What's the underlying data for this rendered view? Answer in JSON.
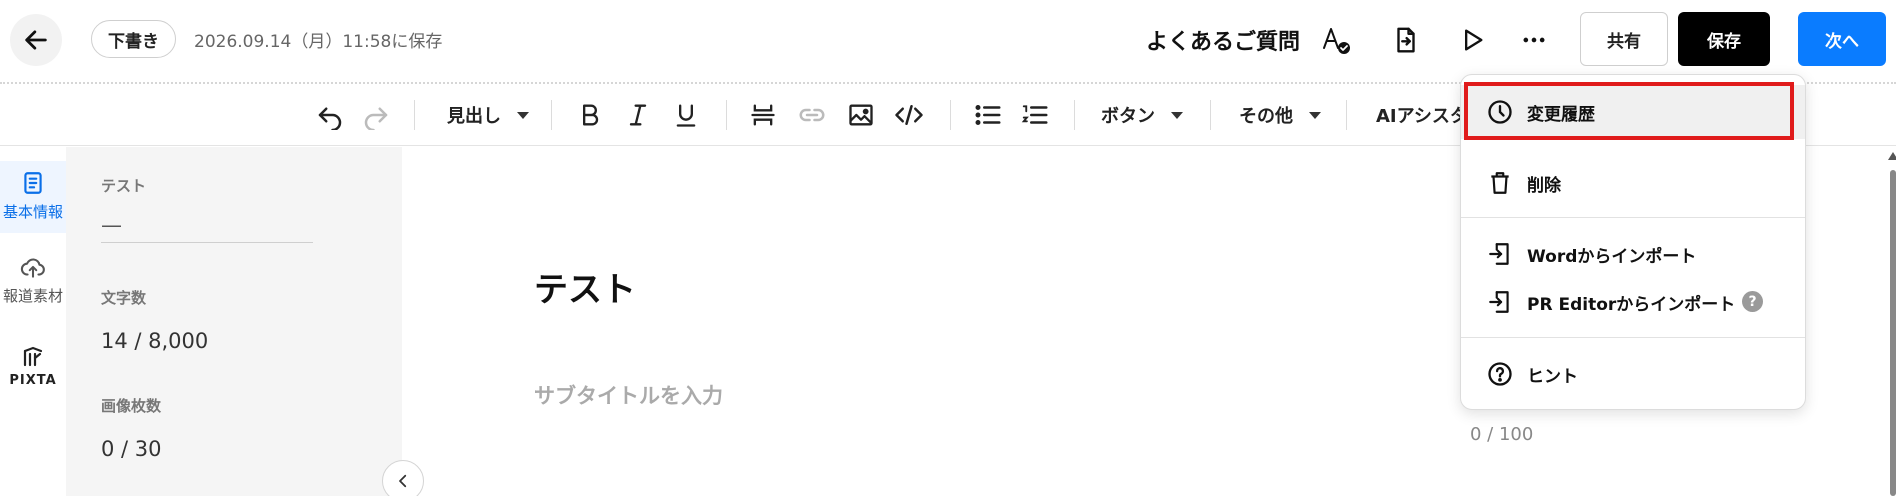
{
  "header": {
    "draft_label": "下書き",
    "save_time": "2026.09.14（月）11:58に保存",
    "title": "よくあるご質問",
    "share_label": "共有",
    "save_label": "保存",
    "next_label": "次へ",
    "icons": [
      "back-arrow-icon",
      "spellcheck-icon",
      "export-icon",
      "preview-play-icon",
      "more-icon"
    ]
  },
  "toolbar": {
    "heading_label": "見出し",
    "button_label": "ボタン",
    "other_label": "その他",
    "ai_label": "AIアシスタ",
    "icons": [
      "undo-icon",
      "redo-icon",
      "bold-icon",
      "italic-icon",
      "underline-icon",
      "divider-icon",
      "link-icon",
      "image-icon",
      "code-icon",
      "bullet-list-icon",
      "numbered-list-icon"
    ]
  },
  "rail": {
    "items": [
      {
        "label": "基本情報",
        "icon": "document-icon",
        "active": true
      },
      {
        "label": "報道素材",
        "icon": "upload-cloud-icon",
        "active": false
      },
      {
        "label": "PIXTA",
        "icon": "pixta-logo-icon",
        "active": false
      }
    ]
  },
  "info": {
    "test_label": "テスト",
    "test_value": "—",
    "chars_label": "文字数",
    "chars_value": "14 / 8,000",
    "images_label": "画像枚数",
    "images_value": "0 / 30"
  },
  "editor": {
    "title": "テスト",
    "subtitle_placeholder": "サブタイトルを入力",
    "subtitle_counter": "0 / 100"
  },
  "menu": {
    "items": [
      {
        "label": "変更履歴",
        "icon": "history-clock-icon",
        "highlighted": true
      },
      {
        "label": "削除",
        "icon": "trash-icon",
        "highlighted": false
      },
      {
        "label": "Wordからインポート",
        "icon": "import-icon",
        "highlighted": false
      },
      {
        "label": "PR Editorからインポート",
        "icon": "import-icon",
        "highlighted": false
      },
      {
        "label": "ヒント",
        "icon": "help-circle-icon",
        "highlighted": false
      }
    ],
    "help_badge": "?"
  },
  "colors": {
    "primary_blue": "#0a7cff",
    "save_black": "#000000",
    "highlight_red": "#e01b1b",
    "active_rail_text": "#0a6fe8"
  }
}
